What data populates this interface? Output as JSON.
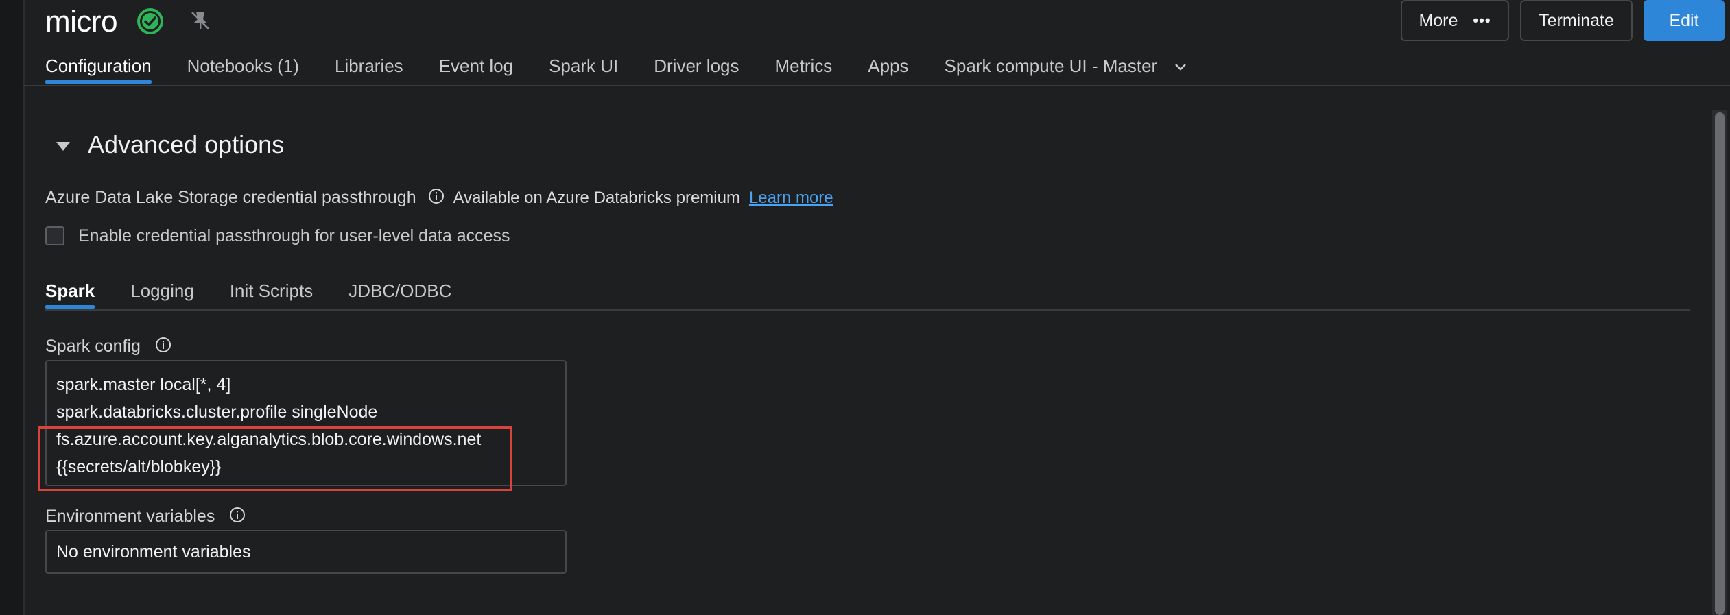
{
  "cluster": {
    "name": "micro",
    "status_icon": "green-check-circle-icon",
    "pin_icon": "pin-off-icon"
  },
  "header_buttons": {
    "more": "More",
    "more_icon": "ellipsis-icon",
    "terminate": "Terminate",
    "edit": "Edit"
  },
  "tabs": [
    {
      "label": "Configuration",
      "active": true
    },
    {
      "label": "Notebooks (1)"
    },
    {
      "label": "Libraries"
    },
    {
      "label": "Event log"
    },
    {
      "label": "Spark UI"
    },
    {
      "label": "Driver logs"
    },
    {
      "label": "Metrics"
    },
    {
      "label": "Apps"
    },
    {
      "label": "Spark compute UI - Master"
    }
  ],
  "advanced_options": {
    "title": "Advanced options",
    "adls": {
      "label": "Azure Data Lake Storage credential passthrough",
      "note": "Available on Azure Databricks premium",
      "link": "Learn more"
    },
    "checkbox_label": "Enable credential passthrough for user-level data access",
    "checkbox_checked": false,
    "sub_tabs": [
      {
        "label": "Spark",
        "active": true
      },
      {
        "label": "Logging"
      },
      {
        "label": "Init Scripts"
      },
      {
        "label": "JDBC/ODBC"
      }
    ],
    "spark_config": {
      "label": "Spark config",
      "lines": [
        "spark.master local[*, 4]",
        "spark.databricks.cluster.profile singleNode",
        "fs.azure.account.key.alganalytics.blob.core.windows.net",
        "{{secrets/alt/blobkey}}"
      ]
    },
    "env_vars": {
      "label": "Environment variables",
      "value": "No environment variables"
    }
  },
  "colors": {
    "accent": "#2e86d8",
    "status_green": "#2fb45a",
    "highlight_red": "#d9433e",
    "link": "#4aa3f0"
  }
}
